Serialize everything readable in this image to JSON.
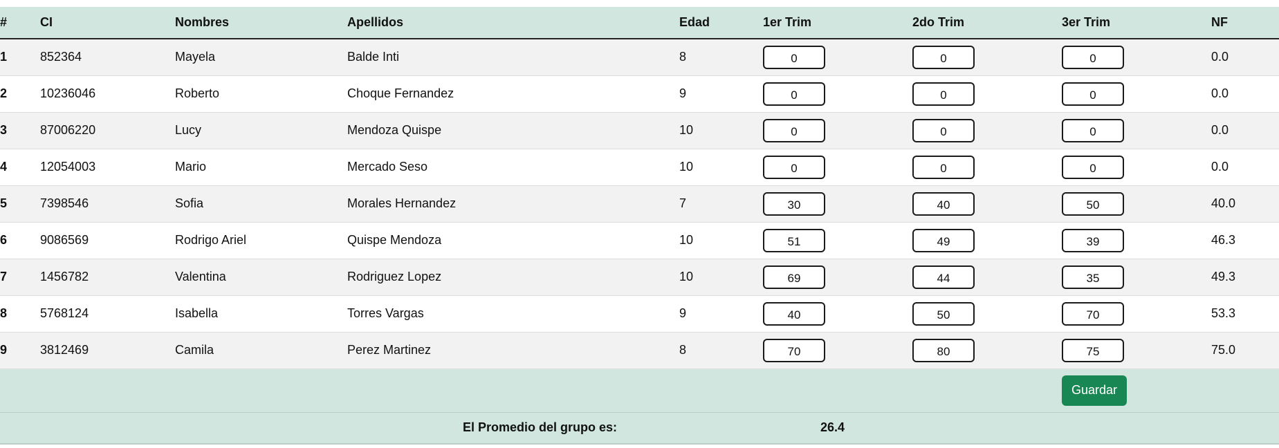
{
  "table": {
    "headers": [
      "#",
      "CI",
      "Nombres",
      "Apellidos",
      "Edad",
      "1er Trim",
      "2do Trim",
      "3er Trim",
      "NF"
    ],
    "rows": [
      {
        "n": "1",
        "ci": "852364",
        "nombres": "Mayela",
        "apellidos": "Balde Inti",
        "edad": "8",
        "t1": "0",
        "t2": "0",
        "t3": "0",
        "nf": "0.0"
      },
      {
        "n": "2",
        "ci": "10236046",
        "nombres": "Roberto",
        "apellidos": "Choque Fernandez",
        "edad": "9",
        "t1": "0",
        "t2": "0",
        "t3": "0",
        "nf": "0.0"
      },
      {
        "n": "3",
        "ci": "87006220",
        "nombres": "Lucy",
        "apellidos": "Mendoza Quispe",
        "edad": "10",
        "t1": "0",
        "t2": "0",
        "t3": "0",
        "nf": "0.0"
      },
      {
        "n": "4",
        "ci": "12054003",
        "nombres": "Mario",
        "apellidos": "Mercado Seso",
        "edad": "10",
        "t1": "0",
        "t2": "0",
        "t3": "0",
        "nf": "0.0"
      },
      {
        "n": "5",
        "ci": "7398546",
        "nombres": "Sofia",
        "apellidos": "Morales Hernandez",
        "edad": "7",
        "t1": "30",
        "t2": "40",
        "t3": "50",
        "nf": "40.0"
      },
      {
        "n": "6",
        "ci": "9086569",
        "nombres": "Rodrigo Ariel",
        "apellidos": "Quispe Mendoza",
        "edad": "10",
        "t1": "51",
        "t2": "49",
        "t3": "39",
        "nf": "46.3"
      },
      {
        "n": "7",
        "ci": "1456782",
        "nombres": "Valentina",
        "apellidos": "Rodriguez Lopez",
        "edad": "10",
        "t1": "69",
        "t2": "44",
        "t3": "35",
        "nf": "49.3"
      },
      {
        "n": "8",
        "ci": "5768124",
        "nombres": "Isabella",
        "apellidos": "Torres Vargas",
        "edad": "9",
        "t1": "40",
        "t2": "50",
        "t3": "70",
        "nf": "53.3"
      },
      {
        "n": "9",
        "ci": "3812469",
        "nombres": "Camila",
        "apellidos": "Perez Martinez",
        "edad": "8",
        "t1": "70",
        "t2": "80",
        "t3": "75",
        "nf": "75.0"
      }
    ]
  },
  "actions": {
    "save_label": "Guardar"
  },
  "summary": {
    "label": "El Promedio del grupo es:",
    "value": "26.4"
  },
  "colors": {
    "header_bg": "#d0e6de",
    "save_button": "#198754",
    "row_alt": "#f2f2f2"
  }
}
